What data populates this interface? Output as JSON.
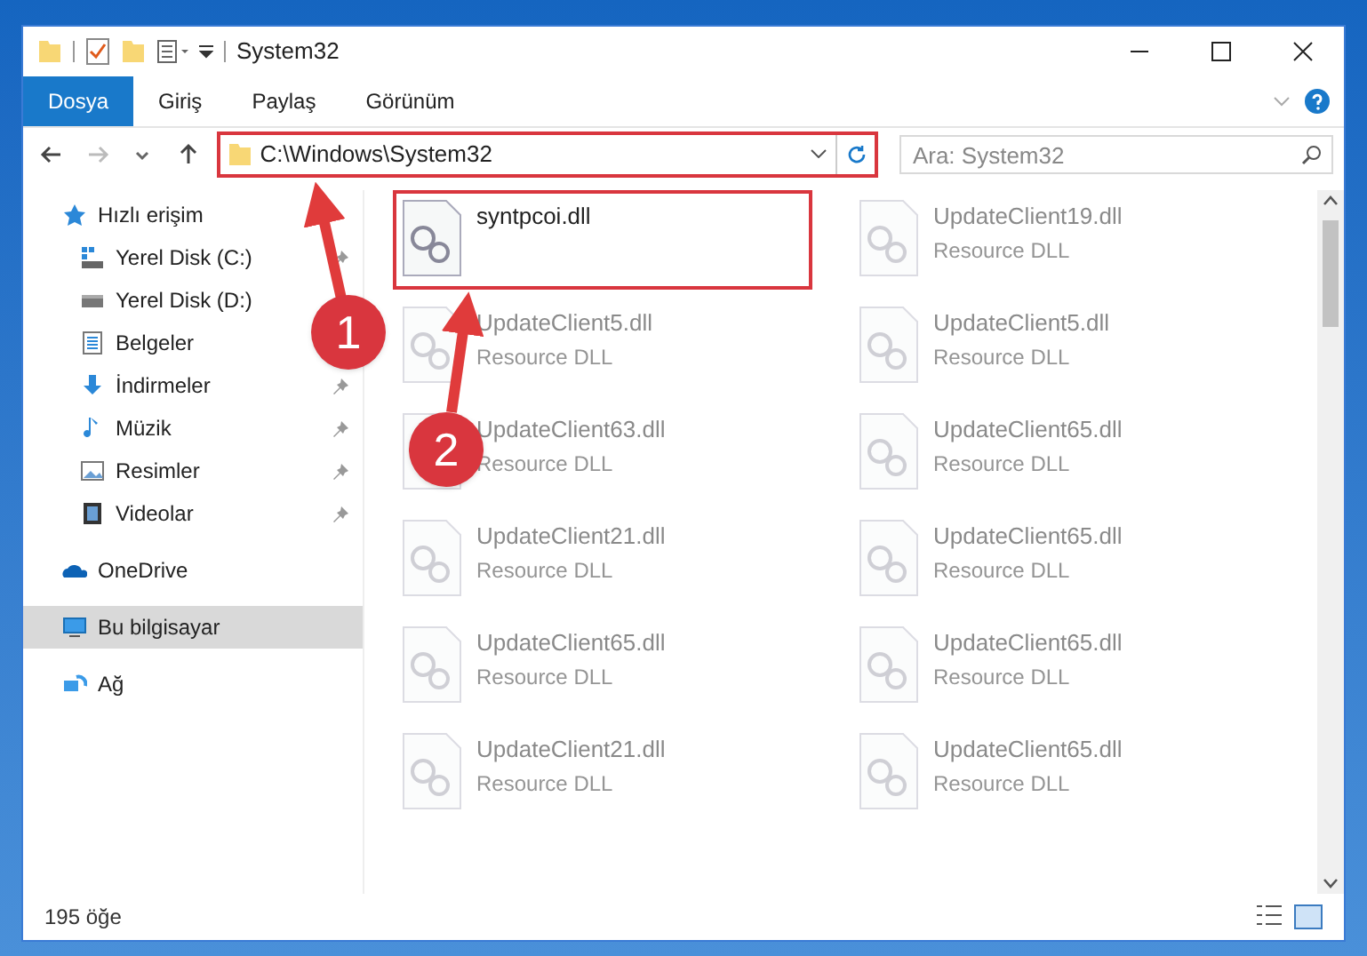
{
  "window": {
    "title": "System32"
  },
  "ribbon_tabs": [
    {
      "label": "Dosya",
      "selected": true
    },
    {
      "label": "Giriş",
      "selected": false
    },
    {
      "label": "Paylaş",
      "selected": false
    },
    {
      "label": "Görünüm",
      "selected": false
    }
  ],
  "address_bar": {
    "path": "C:\\Windows\\System32",
    "highlighted": true
  },
  "search": {
    "placeholder": "Ara: System32"
  },
  "sidebar": {
    "items": [
      {
        "label": "Hızlı erişim",
        "kind": "star",
        "selected": false,
        "children": [
          {
            "label": "Yerel Disk (C:)",
            "kind": "disk-c",
            "pinned": true,
            "selected": false
          },
          {
            "label": "Yerel Disk (D:)",
            "kind": "disk",
            "pinned": false,
            "selected": false
          },
          {
            "label": "Belgeler",
            "kind": "docs",
            "pinned": false,
            "selected": false
          },
          {
            "label": "İndirmeler",
            "kind": "download",
            "pinned": true,
            "selected": false
          },
          {
            "label": "Müzik",
            "kind": "music",
            "pinned": true,
            "selected": false
          },
          {
            "label": "Resimler",
            "kind": "pictures",
            "pinned": true,
            "selected": false
          },
          {
            "label": "Videolar",
            "kind": "videos",
            "pinned": true,
            "selected": false
          }
        ]
      },
      {
        "label": "OneDrive",
        "kind": "cloud",
        "selected": false
      },
      {
        "label": "Bu bilgisayar",
        "kind": "pc",
        "selected": true
      },
      {
        "label": "Ağ",
        "kind": "network",
        "selected": false
      }
    ]
  },
  "files": [
    {
      "name": "syntpcoi.dll",
      "highlighted": true,
      "dimmed": false
    },
    {
      "name": "UpdateClient19.dll",
      "type": "Resource DLL",
      "highlighted": false,
      "dimmed": true
    },
    {
      "name": "UpdateClient5.dll",
      "type": "Resource DLL",
      "highlighted": false,
      "dimmed": true
    },
    {
      "name": "UpdateClient5.dll",
      "type": "Resource DLL",
      "highlighted": false,
      "dimmed": true
    },
    {
      "name": "UpdateClient63.dll",
      "type": "Resource DLL",
      "highlighted": false,
      "dimmed": true
    },
    {
      "name": "UpdateClient65.dll",
      "type": "Resource DLL",
      "highlighted": false,
      "dimmed": true
    },
    {
      "name": "UpdateClient21.dll",
      "type": "Resource DLL",
      "highlighted": false,
      "dimmed": true
    },
    {
      "name": "UpdateClient65.dll",
      "type": "Resource DLL",
      "highlighted": false,
      "dimmed": true
    },
    {
      "name": "UpdateClient65.dll",
      "type": "Resource DLL",
      "highlighted": false,
      "dimmed": true
    },
    {
      "name": "UpdateClient65.dll",
      "type": "Resource DLL",
      "highlighted": false,
      "dimmed": true
    },
    {
      "name": "UpdateClient21.dll",
      "type": "Resource DLL",
      "highlighted": false,
      "dimmed": true
    },
    {
      "name": "UpdateClient65.dll",
      "type": "Resource DLL",
      "highlighted": false,
      "dimmed": true
    }
  ],
  "annotations": [
    {
      "label": "1"
    },
    {
      "label": "2"
    }
  ],
  "status_bar": {
    "count": "195 öğe"
  }
}
